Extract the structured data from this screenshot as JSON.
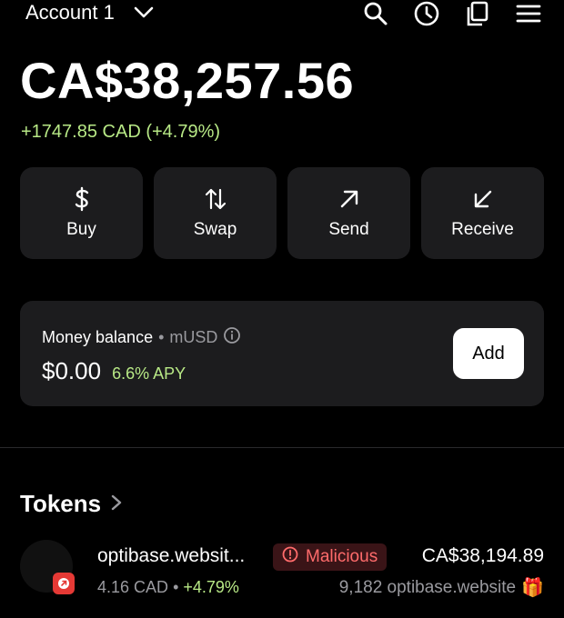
{
  "header": {
    "account_label": "Account 1",
    "icons": [
      "search-icon",
      "history-icon",
      "copy-icon",
      "menu-icon"
    ]
  },
  "balance": {
    "total": "CA$38,257.56",
    "change": "+1747.85 CAD (+4.79%)",
    "change_color": "#b8e986"
  },
  "actions": [
    {
      "label": "Buy",
      "icon": "dollar-icon"
    },
    {
      "label": "Swap",
      "icon": "swap-icon"
    },
    {
      "label": "Send",
      "icon": "arrow-up-right-icon"
    },
    {
      "label": "Receive",
      "icon": "arrow-down-left-icon"
    }
  ],
  "money": {
    "title": "Money balance",
    "separator": "•",
    "currency": "mUSD",
    "amount": "$0.00",
    "apy": "6.6% APY",
    "add_label": "Add"
  },
  "tokens": {
    "title": "Tokens",
    "items": [
      {
        "name": "optibase.websit...",
        "warning": "Malicious",
        "value": "CA$38,194.89",
        "price": "4.16 CAD",
        "separator": "•",
        "change": "+4.79%",
        "quantity": "9,182 optibase.website",
        "quantity_icon": "🎁"
      }
    ]
  },
  "colors": {
    "background": "#000000",
    "card": "#1c1c1e",
    "positive": "#b8e986",
    "danger": "#ff6b6b"
  }
}
